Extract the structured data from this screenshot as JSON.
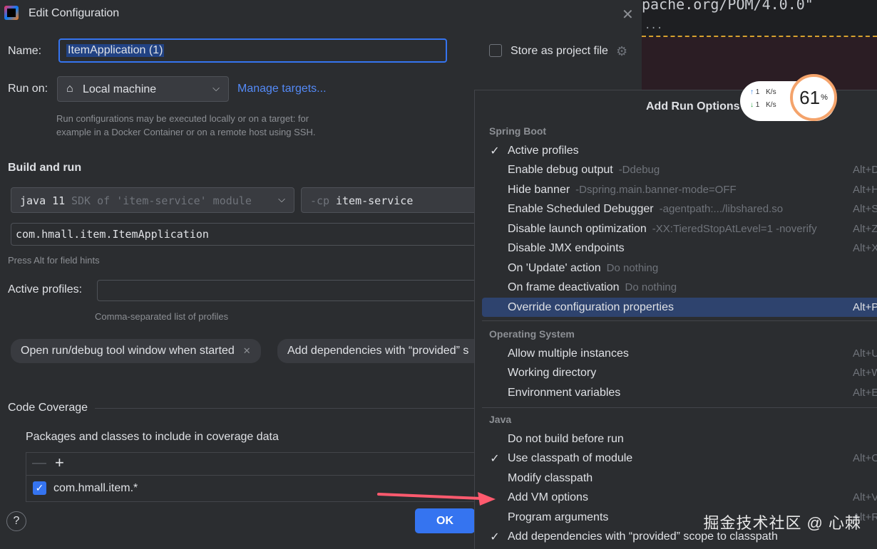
{
  "editor": {
    "code_line": "pache.org/POM/4.0.0\"",
    "fold_marker": "..."
  },
  "dialog": {
    "title": "Edit Configuration",
    "name_label": "Name:",
    "name_value": "ItemApplication (1)",
    "store_label": "Store as project file",
    "run_on_label": "Run on:",
    "run_on_value": "Local machine",
    "manage_targets": "Manage targets...",
    "run_on_hint_1": "Run configurations may be executed locally or on a target: for",
    "run_on_hint_2": "example in a Docker Container or on a remote host using SSH.",
    "build_and_run": "Build and run",
    "jdk_value": "java 11",
    "jdk_hint": "SDK of 'item-service' module",
    "cp_flag": "-cp",
    "cp_value": "item-service",
    "main_class": "com.hmall.item.ItemApplication",
    "alt_hint": "Press Alt for field hints",
    "active_profiles_label": "Active profiles:",
    "active_profiles_value": "",
    "profiles_hint": "Comma-separated list of profiles",
    "chip_1": "Open run/debug tool window when started",
    "chip_2": "Add dependencies with “provided” s",
    "code_coverage": "Code Coverage",
    "packages_label": "Packages and classes to include in coverage data",
    "package_item": "com.hmall.item.*",
    "ok": "OK",
    "help": "?"
  },
  "popup": {
    "title": "Add Run Options",
    "groups": {
      "spring_boot": "Spring Boot",
      "os": "Operating System",
      "java": "Java"
    },
    "items": [
      {
        "checked": "✓",
        "label": "Active profiles",
        "hint": "",
        "shortcut": ""
      },
      {
        "checked": "",
        "label": "Enable debug output",
        "hint": "-Ddebug",
        "shortcut": "Alt+D"
      },
      {
        "checked": "",
        "label": "Hide banner",
        "hint": "-Dspring.main.banner-mode=OFF",
        "shortcut": "Alt+H"
      },
      {
        "checked": "",
        "label": "Enable Scheduled Debugger",
        "hint": "-agentpath:.../libshared.so",
        "shortcut": "Alt+S"
      },
      {
        "checked": "",
        "label": "Disable launch optimization",
        "hint": "-XX:TieredStopAtLevel=1 -noverify",
        "shortcut": "Alt+Z"
      },
      {
        "checked": "",
        "label": "Disable JMX endpoints",
        "hint": "",
        "shortcut": "Alt+X"
      },
      {
        "checked": "",
        "label": "On 'Update' action",
        "hint": "Do nothing",
        "shortcut": ""
      },
      {
        "checked": "",
        "label": "On frame deactivation",
        "hint": "Do nothing",
        "shortcut": ""
      },
      {
        "checked": "",
        "label": "Override configuration properties",
        "hint": "",
        "shortcut": "Alt+P"
      },
      {
        "checked": "",
        "label": "Allow multiple instances",
        "hint": "",
        "shortcut": "Alt+U"
      },
      {
        "checked": "",
        "label": "Working directory",
        "hint": "",
        "shortcut": "Alt+W"
      },
      {
        "checked": "",
        "label": "Environment variables",
        "hint": "",
        "shortcut": "Alt+E"
      },
      {
        "checked": "",
        "label": "Do not build before run",
        "hint": "",
        "shortcut": ""
      },
      {
        "checked": "✓",
        "label": "Use classpath of module",
        "hint": "",
        "shortcut": "Alt+O"
      },
      {
        "checked": "",
        "label": "Modify classpath",
        "hint": "",
        "shortcut": ""
      },
      {
        "checked": "",
        "label": "Add VM options",
        "hint": "",
        "shortcut": "Alt+V"
      },
      {
        "checked": "",
        "label": "Program arguments",
        "hint": "",
        "shortcut": "Alt+R"
      },
      {
        "checked": "✓",
        "label": "Add dependencies with “provided” scope to classpath",
        "hint": "",
        "shortcut": ""
      }
    ]
  },
  "network": {
    "up": "1",
    "down": "1",
    "unit": "K/s",
    "percent": "61",
    "percent_sign": "%"
  },
  "watermark": "掘金技术社区 @ 心棘",
  "colors": {
    "accent": "#3574f0",
    "selection": "#2e436e",
    "arrow": "#ff5a6e"
  }
}
